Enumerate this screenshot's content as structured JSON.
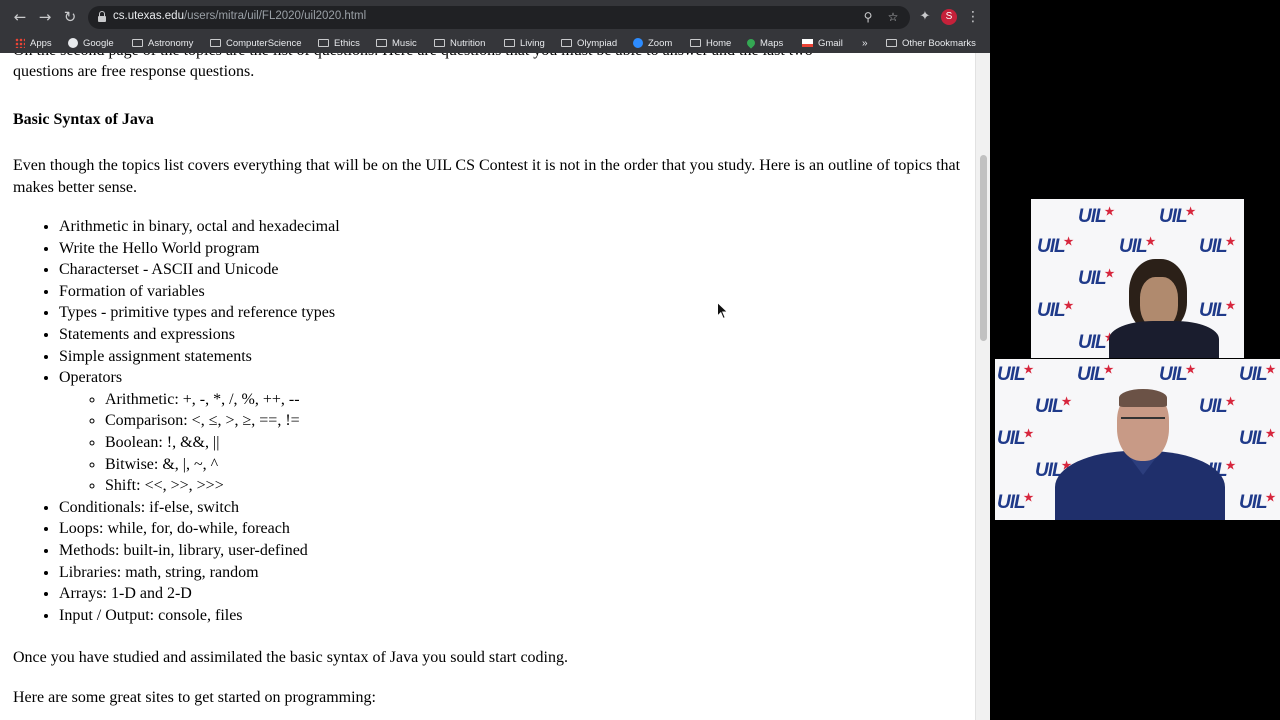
{
  "browser": {
    "url_host": "cs.utexas.edu",
    "url_path": "/users/mitra/uil/FL2020/uil2020.html",
    "profile_initial": "S",
    "icons": {
      "back": "back-arrow-icon",
      "forward": "forward-arrow-icon",
      "reload": "reload-icon",
      "lock": "lock-icon",
      "zoom": "zoom-icon",
      "star": "bookmark-star-icon",
      "extensions": "puzzle-icon",
      "menu": "kebab-menu-icon"
    }
  },
  "bookmarks": {
    "items": [
      {
        "label": "Apps",
        "icon": "apps-grid-icon"
      },
      {
        "label": "Google",
        "icon": "google-icon"
      },
      {
        "label": "Astronomy",
        "icon": "folder-icon"
      },
      {
        "label": "ComputerScience",
        "icon": "folder-icon"
      },
      {
        "label": "Ethics",
        "icon": "folder-icon"
      },
      {
        "label": "Music",
        "icon": "folder-icon"
      },
      {
        "label": "Nutrition",
        "icon": "folder-icon"
      },
      {
        "label": "Living",
        "icon": "folder-icon"
      },
      {
        "label": "Olympiad",
        "icon": "folder-icon"
      },
      {
        "label": "Zoom",
        "icon": "zoom-app-icon"
      },
      {
        "label": "Home",
        "icon": "folder-icon"
      },
      {
        "label": "Maps",
        "icon": "maps-icon"
      },
      {
        "label": "Gmail",
        "icon": "gmail-icon"
      }
    ],
    "overflow": "»",
    "other": "Other Bookmarks"
  },
  "page": {
    "clipped_top_line": "On the second page of the topics are the list of questions. Here are questions that you must be able to answer and the last two",
    "p1_tail": "questions are free response questions.",
    "heading": "Basic Syntax of Java",
    "intro": "Even though the topics list covers everything that will be on the UIL CS Contest it is not in the order that you study. Here is an outline of topics that makes better sense.",
    "topics": [
      "Arithmetic in binary, octal and hexadecimal",
      "Write the Hello World program",
      "Characterset - ASCII and Unicode",
      "Formation of variables",
      "Types - primitive types and reference types",
      "Statements and expressions",
      "Simple assignment statements",
      "Operators"
    ],
    "operators": [
      "Arithmetic: +, -, *, /, %, ++, --",
      "Comparison: <, ≤, >, ≥, ==, !=",
      "Boolean: !, &&, ||",
      "Bitwise: &, |, ~, ^",
      "Shift: <<, >>, >>>"
    ],
    "topics_after": [
      "Conditionals: if-else, switch",
      "Loops: while, for, do-while, foreach",
      "Methods: built-in, library, user-defined",
      "Libraries: math, string, random",
      "Arrays: 1-D and 2-D",
      "Input / Output: console, files"
    ],
    "after1": "Once you have studied and assimilated the basic syntax of Java you sould start coding.",
    "after2": "Here are some great sites to get started on programming:"
  },
  "video": {
    "logo_text": "UIL",
    "colors": {
      "logo_blue": "#1f3a8a",
      "logo_red": "#d7263d"
    }
  }
}
